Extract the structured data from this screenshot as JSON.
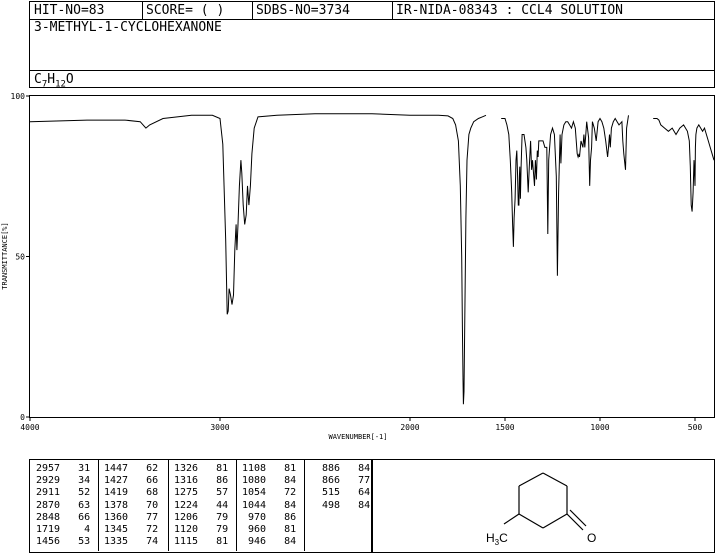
{
  "header": {
    "hit_no": "HIT-NO=83",
    "score": "SCORE=  (   )",
    "sdbs_no": "SDBS-NO=3734",
    "ir_nida": "IR-NIDA-08343 : CCL4 SOLUTION",
    "compound_name": "3-METHYL-1-CYCLOHEXANONE",
    "formula_c": "C",
    "formula_c_sub": "7",
    "formula_h": "H",
    "formula_h_sub": "12",
    "formula_o": "O"
  },
  "chart_data": {
    "type": "line",
    "xlabel": "WAVENUMBER[-1]",
    "ylabel": "TRANSMITTANCE[%]",
    "x_reversed": true,
    "xlim": [
      4000,
      400
    ],
    "ylim": [
      0,
      100
    ],
    "x_ticks": [
      4000,
      3000,
      2000,
      1500,
      1000,
      500
    ],
    "x_tick_labels": [
      "4000",
      "3000",
      "2000",
      "1500",
      "1000",
      "500"
    ],
    "y_ticks": [
      0,
      50,
      100
    ],
    "y_tick_labels": [
      "0",
      "50",
      "100"
    ],
    "grid": false,
    "series": [
      {
        "segment": 1,
        "x": [
          4000,
          3700,
          3500,
          3420,
          3390,
          3370,
          3300,
          3150,
          3040,
          3000,
          2985,
          2970,
          2962,
          2957,
          2952,
          2945,
          2937,
          2929,
          2922,
          2915,
          2911,
          2905,
          2898,
          2890,
          2885,
          2878,
          2870,
          2862,
          2855,
          2848,
          2840,
          2832,
          2820,
          2800,
          2700,
          2500,
          2200,
          2000,
          1900,
          1850,
          1800,
          1775,
          1760,
          1745,
          1735,
          1728,
          1724,
          1721,
          1719,
          1716,
          1712,
          1706,
          1700,
          1690,
          1680,
          1665,
          1640,
          1620,
          1600
        ],
        "y": [
          92,
          92.5,
          92.5,
          92,
          90,
          91,
          93,
          94,
          94,
          93,
          85,
          55,
          32,
          33,
          40,
          38,
          35,
          38,
          52,
          60,
          52,
          60,
          72,
          80,
          76,
          66,
          60,
          63,
          72,
          66,
          72,
          82,
          90,
          93.5,
          94,
          94.5,
          94.5,
          94,
          94,
          94,
          93.8,
          93,
          91,
          86,
          72,
          50,
          28,
          12,
          4,
          8,
          28,
          62,
          80,
          88,
          90,
          92,
          93,
          93.5,
          94
        ]
      },
      {
        "segment": 2,
        "x": [
          1520,
          1500,
          1490,
          1480,
          1472,
          1465,
          1460,
          1456,
          1452,
          1447,
          1442,
          1438,
          1434,
          1430,
          1427,
          1424,
          1422,
          1419,
          1415,
          1410,
          1400,
          1390,
          1385,
          1378,
          1372,
          1365,
          1360,
          1355,
          1350,
          1345,
          1340,
          1335,
          1330,
          1326,
          1322,
          1316,
          1310,
          1300,
          1290,
          1280,
          1275,
          1270,
          1260,
          1250,
          1240,
          1230,
          1224,
          1218,
          1210,
          1206,
          1200,
          1190,
          1180,
          1170,
          1160,
          1150,
          1140,
          1130,
          1120,
          1115,
          1110,
          1108,
          1100,
          1090,
          1085,
          1080,
          1075,
          1070,
          1060,
          1054,
          1050,
          1044,
          1040,
          1030,
          1020,
          1010,
          1000,
          990,
          980,
          970,
          960,
          955,
          950,
          946,
          940,
          930,
          920,
          910,
          900,
          885,
          880,
          875,
          866,
          860,
          850
        ],
        "y": [
          93,
          93,
          91,
          88,
          80,
          70,
          60,
          53,
          62,
          68,
          80,
          83,
          76,
          66,
          66,
          75,
          78,
          68,
          78,
          88,
          88,
          84,
          80,
          70,
          78,
          86,
          77,
          80,
          76,
          72,
          80,
          74,
          83,
          81,
          86,
          86,
          86,
          86,
          84,
          84,
          57,
          80,
          88,
          90,
          88,
          75,
          44,
          70,
          88,
          79,
          88,
          91,
          92,
          92,
          91,
          90,
          92,
          90,
          82,
          81,
          82,
          81,
          86,
          84,
          88,
          84,
          88,
          92,
          87,
          72,
          80,
          84,
          92,
          90,
          86,
          92,
          93,
          92,
          90,
          86,
          81,
          84,
          88,
          84,
          90,
          92,
          93,
          92,
          91,
          92,
          86,
          82,
          77,
          90,
          94
        ]
      },
      {
        "segment": 3,
        "x": [
          720,
          700,
          690,
          680,
          660,
          640,
          620,
          600,
          580,
          560,
          540,
          530,
          525,
          520,
          515,
          510,
          505,
          500,
          498,
          495,
          490,
          480,
          470,
          460,
          450,
          440,
          430,
          420,
          410,
          400
        ],
        "y": [
          93,
          93,
          92.5,
          91,
          90,
          89,
          90,
          88,
          90,
          91,
          89,
          86,
          78,
          66,
          64,
          70,
          80,
          72,
          84,
          88,
          90,
          91,
          90,
          89,
          90,
          88,
          86,
          84,
          82,
          80
        ]
      }
    ]
  },
  "peak_table": {
    "columns": [
      [
        [
          "2957",
          "31"
        ],
        [
          "2929",
          "34"
        ],
        [
          "2911",
          "52"
        ],
        [
          "2870",
          "63"
        ],
        [
          "2848",
          "66"
        ],
        [
          "1719",
          "4"
        ],
        [
          "1456",
          "53"
        ]
      ],
      [
        [
          "1447",
          "62"
        ],
        [
          "1427",
          "66"
        ],
        [
          "1419",
          "68"
        ],
        [
          "1378",
          "70"
        ],
        [
          "1360",
          "77"
        ],
        [
          "1345",
          "72"
        ],
        [
          "1335",
          "74"
        ]
      ],
      [
        [
          "1326",
          "81"
        ],
        [
          "1316",
          "86"
        ],
        [
          "1275",
          "57"
        ],
        [
          "1224",
          "44"
        ],
        [
          "1206",
          "79"
        ],
        [
          "1120",
          "79"
        ],
        [
          "1115",
          "81"
        ]
      ],
      [
        [
          "1108",
          "81"
        ],
        [
          "1080",
          "84"
        ],
        [
          "1054",
          "72"
        ],
        [
          "1044",
          "84"
        ],
        [
          "970",
          "86"
        ],
        [
          "960",
          "81"
        ],
        [
          "946",
          "84"
        ]
      ],
      [
        [
          "886",
          "84"
        ],
        [
          "866",
          "77"
        ],
        [
          "515",
          "64"
        ],
        [
          "498",
          "84"
        ],
        [
          "",
          ""
        ],
        [
          "",
          ""
        ],
        [
          "",
          ""
        ]
      ]
    ]
  },
  "structure": {
    "methyl_h": "H",
    "methyl_sub": "3",
    "methyl_c": "C",
    "carbonyl_o": "O"
  }
}
